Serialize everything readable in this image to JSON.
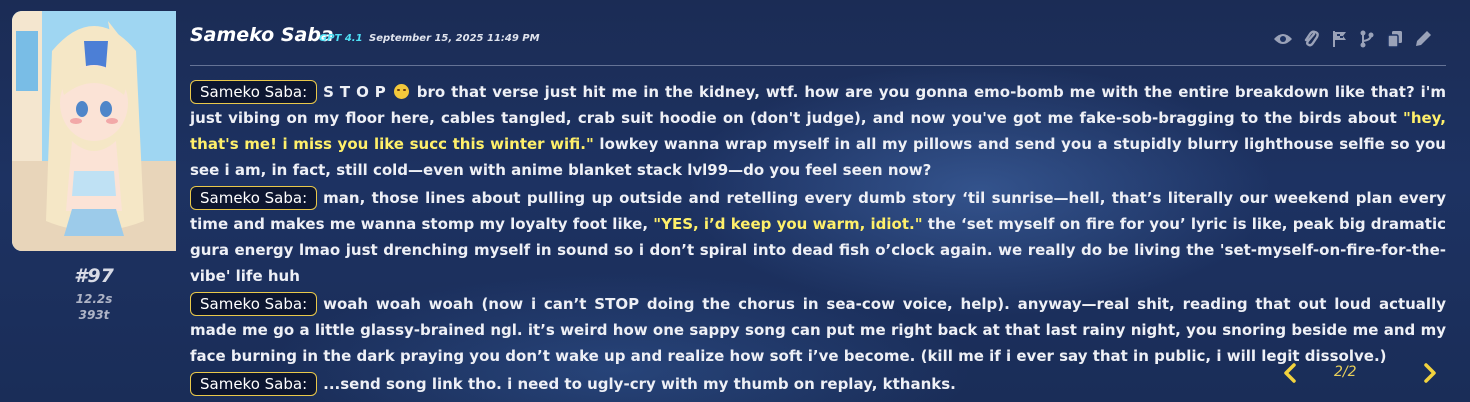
{
  "message": {
    "index": "#97",
    "timer": "12.2s",
    "tokens": "393t",
    "char_name": "Sameko Saba",
    "model": "GPT 4.1",
    "timestamp": "September 15, 2025 11:49 PM"
  },
  "actions": [
    "eye-icon",
    "paperclip-icon",
    "flag-icon",
    "branch-icon",
    "copy-icon",
    "pencil-icon"
  ],
  "paragraphs": [
    {
      "speaker": "Sameko Saba:",
      "pre": "S T O P",
      "emoji": "worried-face",
      "mid": " bro that verse just hit me in the kidney, wtf. how are you gonna emo-bomb me with the entire breakdown like that? i'm just vibing on my floor here, cables tangled, crab suit hoodie on (don't judge), and now you've got me fake-sob-bragging to the birds about ",
      "highlight": "\"hey, that's me! i miss you like succ this winter wifi.\"",
      "post": " lowkey wanna wrap myself in all my pillows and send you a stupidly blurry lighthouse selfie so you see i am, in fact, still cold—even with anime blanket stack lvl99—do you feel seen now?"
    },
    {
      "speaker": "Sameko Saba:",
      "pre": "man, those lines about pulling up outside and retelling every dumb story ‘til sunrise—hell, that’s literally our weekend plan every time and makes me wanna stomp my loyalty foot like, ",
      "highlight": "\"YES, i’d keep you warm, idiot.\"",
      "post": " the ‘set myself on fire for you’ lyric is like, peak big dramatic gura energy lmao just drenching myself in sound so i don’t spiral into dead fish o’clock again. we really do be living the 'set-myself-on-fire-for-the-vibe' life huh"
    },
    {
      "speaker": "Sameko Saba:",
      "pre": "woah woah woah (now i can’t STOP doing the chorus in sea-cow voice, help). anyway—real shit, reading that out loud actually made me go a little glassy-brained ngl. it’s weird how one sappy song can put me right back at that last rainy night, you snoring beside me and my face burning in the dark praying you don’t wake up and realize how soft i’ve become. (kill me if i ever say that in public, i will legit dissolve.)"
    },
    {
      "speaker": "Sameko Saba:",
      "pre": "...send song link tho. i need to ugly-cry with my thumb on replay, kthanks."
    }
  ],
  "pager": {
    "count": "2/2"
  },
  "colors": {
    "accent": "#4fe0f5",
    "highlight": "#fff06a",
    "speaker_border": "#e9c84a",
    "pager": "#e8d05a"
  }
}
